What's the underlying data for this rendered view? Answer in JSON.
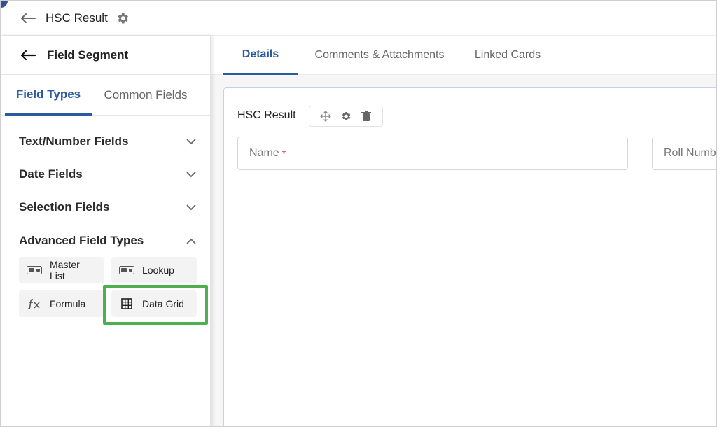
{
  "header": {
    "title": "HSC Result"
  },
  "tabs": [
    {
      "label": "Details",
      "active": true
    },
    {
      "label": "Comments & Attachments",
      "active": false
    },
    {
      "label": "Linked Cards",
      "active": false
    }
  ],
  "form": {
    "section_title": "HSC Result",
    "fields": [
      {
        "label": "Name",
        "required": "*"
      },
      {
        "label": "Roll Numb"
      }
    ]
  },
  "panel": {
    "title": "Field Segment",
    "tabs": [
      {
        "label": "Field Types",
        "active": true
      },
      {
        "label": "Common Fields",
        "active": false
      }
    ],
    "groups": [
      {
        "label": "Text/Number Fields",
        "expanded": false
      },
      {
        "label": "Date Fields",
        "expanded": false
      },
      {
        "label": "Selection Fields",
        "expanded": false
      },
      {
        "label": "Advanced Field Types",
        "expanded": true
      }
    ],
    "advanced_items": [
      {
        "label": "Master List",
        "icon": "toggle-field-icon"
      },
      {
        "label": "Lookup",
        "icon": "toggle-field-icon"
      },
      {
        "label": "Formula",
        "icon": "function-icon"
      },
      {
        "label": "Data Grid",
        "icon": "grid-icon"
      }
    ]
  },
  "colors": {
    "accent": "#2b5aa0",
    "highlight": "#4caf50",
    "required": "#d23a3a"
  }
}
